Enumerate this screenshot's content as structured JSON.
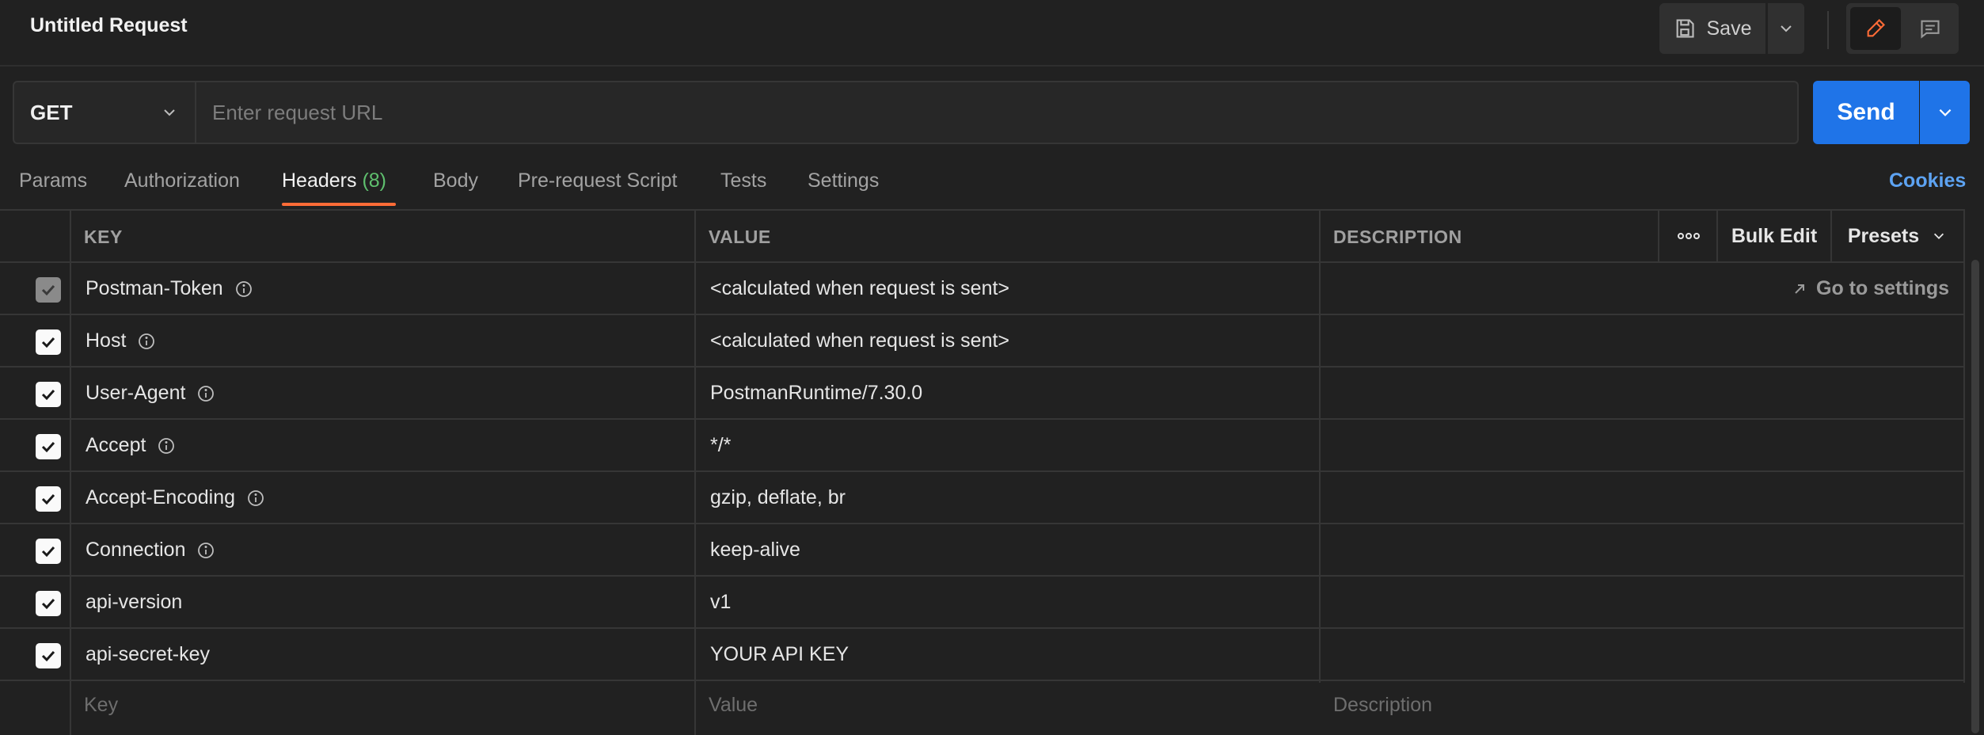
{
  "header": {
    "title": "Untitled Request",
    "save_label": "Save"
  },
  "request": {
    "method": "GET",
    "url_value": "",
    "url_placeholder": "Enter request URL",
    "send_label": "Send"
  },
  "tabs": [
    {
      "label": "Params"
    },
    {
      "label": "Authorization"
    },
    {
      "label": "Headers",
      "count": "(8)",
      "active": true
    },
    {
      "label": "Body"
    },
    {
      "label": "Pre-request Script"
    },
    {
      "label": "Tests"
    },
    {
      "label": "Settings"
    }
  ],
  "cookies_label": "Cookies",
  "table": {
    "columns": {
      "key": "KEY",
      "value": "VALUE",
      "description": "DESCRIPTION"
    },
    "bulk_edit_label": "Bulk Edit",
    "presets_label": "Presets",
    "goto_settings_label": "Go to settings",
    "rows": [
      {
        "key": "Postman-Token",
        "value": "<calculated when request is sent>",
        "checked": true,
        "disabled": true,
        "info": true
      },
      {
        "key": "Host",
        "value": "<calculated when request is sent>",
        "checked": true,
        "info": true
      },
      {
        "key": "User-Agent",
        "value": "PostmanRuntime/7.30.0",
        "checked": true,
        "info": true
      },
      {
        "key": "Accept",
        "value": "*/*",
        "checked": true,
        "info": true
      },
      {
        "key": "Accept-Encoding",
        "value": "gzip, deflate, br",
        "checked": true,
        "info": true
      },
      {
        "key": "Connection",
        "value": "keep-alive",
        "checked": true,
        "info": true
      },
      {
        "key": "api-version",
        "value": "v1",
        "checked": true,
        "info": false
      },
      {
        "key": "api-secret-key",
        "value": "YOUR API KEY",
        "checked": true,
        "info": false
      }
    ],
    "placeholders": {
      "key": "Key",
      "value": "Value",
      "description": "Description"
    }
  },
  "colors": {
    "accent_send": "#1f74e8",
    "tab_underline": "#ff6c37",
    "header_count": "#5fbf6e",
    "cookies_link": "#5da3f2",
    "background": "#212121"
  },
  "icons": {
    "save": "save-icon",
    "edit": "pencil-icon",
    "comment": "comment-icon",
    "info": "info-icon",
    "more": "more-horizontal-icon",
    "goto": "arrow-up-right-icon",
    "check": "check-icon",
    "chevron": "chevron-down-icon"
  }
}
